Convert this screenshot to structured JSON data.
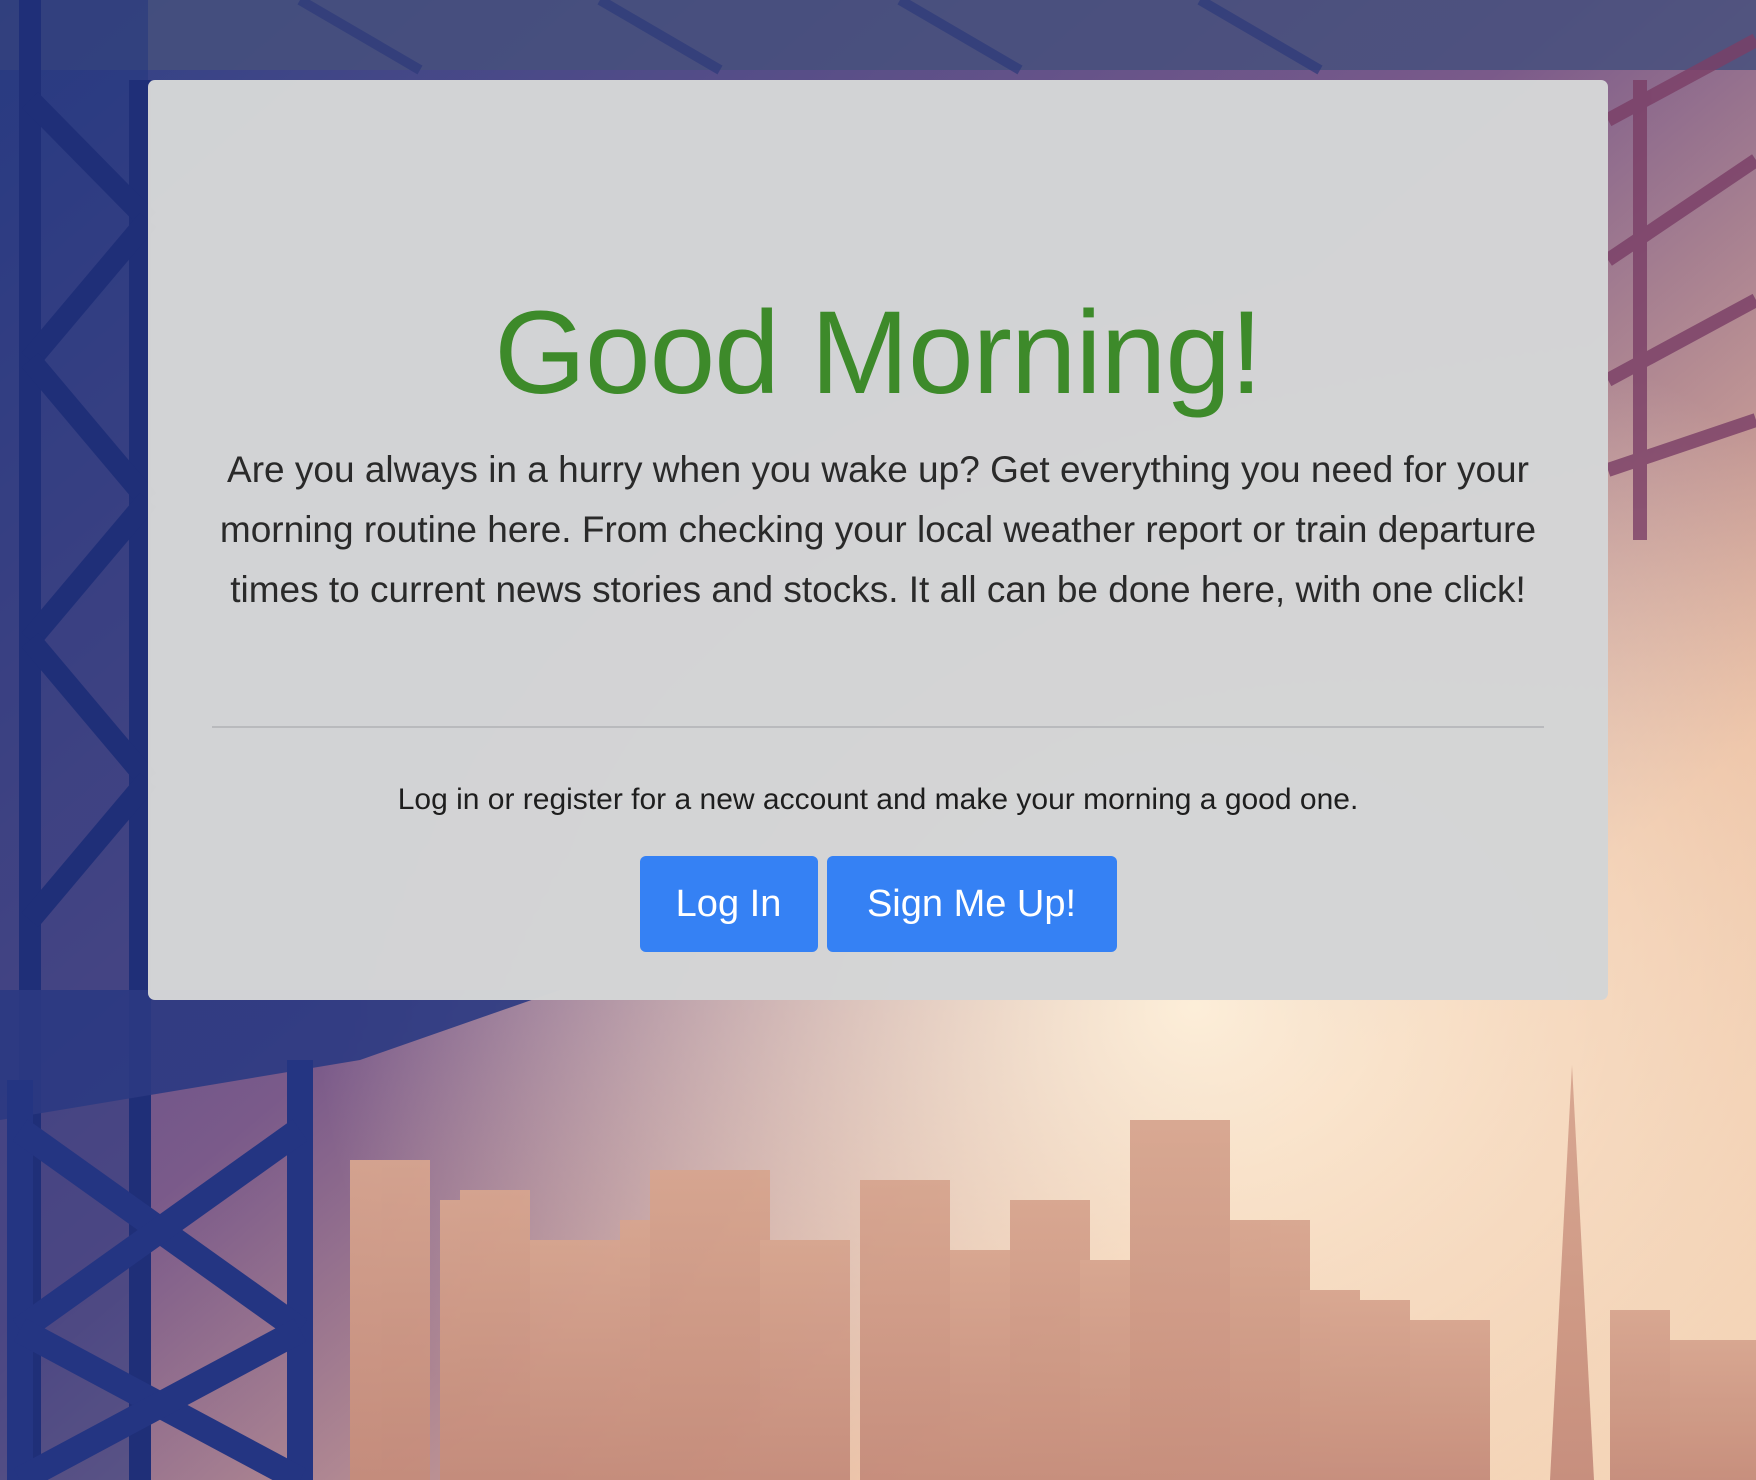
{
  "theme": {
    "headline_color": "#3d8a2a",
    "button_color": "#3581f4",
    "panel_color": "#d3d4d6"
  },
  "hero": {
    "headline": "Good Morning!",
    "lead": "Are you always in a hurry when you wake up? Get everything you need for your morning routine here. From checking your local weather report or train departure times to current news stories and stocks. It all can be done here, with one click!",
    "sub": "Log in or register for a new account and make your morning a good one."
  },
  "actions": {
    "login_label": "Log In",
    "signup_label": "Sign Me Up!"
  }
}
